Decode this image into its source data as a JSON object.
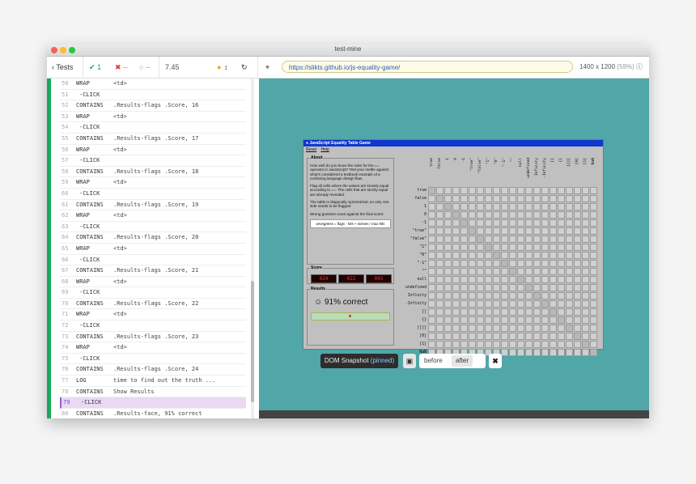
{
  "window": {
    "title": "test-mine"
  },
  "toolbar": {
    "tests_label": "Tests",
    "passed": "1",
    "failed": "--",
    "pending": "--",
    "duration": "7.45",
    "url": "https://slikts.github.io/js-equality-game/",
    "viewport": "1400 x 1200",
    "viewport_pct": "(59%)"
  },
  "commands": [
    {
      "n": "50",
      "name": "WRAP",
      "msg": "<td>",
      "child": false
    },
    {
      "n": "51",
      "name": "-CLICK",
      "msg": "",
      "child": true
    },
    {
      "n": "52",
      "name": "CONTAINS",
      "msg": ".Results-flags .Score, 16",
      "child": false
    },
    {
      "n": "53",
      "name": "WRAP",
      "msg": "<td>",
      "child": false
    },
    {
      "n": "54",
      "name": "-CLICK",
      "msg": "",
      "child": true
    },
    {
      "n": "55",
      "name": "CONTAINS",
      "msg": ".Results-flags .Score, 17",
      "child": false
    },
    {
      "n": "56",
      "name": "WRAP",
      "msg": "<td>",
      "child": false
    },
    {
      "n": "57",
      "name": "-CLICK",
      "msg": "",
      "child": true
    },
    {
      "n": "58",
      "name": "CONTAINS",
      "msg": ".Results-flags .Score, 18",
      "child": false
    },
    {
      "n": "59",
      "name": "WRAP",
      "msg": "<td>",
      "child": false
    },
    {
      "n": "60",
      "name": "-CLICK",
      "msg": "",
      "child": true
    },
    {
      "n": "61",
      "name": "CONTAINS",
      "msg": ".Results-flags .Score, 19",
      "child": false
    },
    {
      "n": "62",
      "name": "WRAP",
      "msg": "<td>",
      "child": false
    },
    {
      "n": "63",
      "name": "-CLICK",
      "msg": "",
      "child": true
    },
    {
      "n": "64",
      "name": "CONTAINS",
      "msg": ".Results-flags .Score, 20",
      "child": false
    },
    {
      "n": "65",
      "name": "WRAP",
      "msg": "<td>",
      "child": false
    },
    {
      "n": "66",
      "name": "-CLICK",
      "msg": "",
      "child": true
    },
    {
      "n": "67",
      "name": "CONTAINS",
      "msg": ".Results-flags .Score, 21",
      "child": false
    },
    {
      "n": "68",
      "name": "WRAP",
      "msg": "<td>",
      "child": false
    },
    {
      "n": "69",
      "name": "-CLICK",
      "msg": "",
      "child": true
    },
    {
      "n": "70",
      "name": "CONTAINS",
      "msg": ".Results-flags .Score, 22",
      "child": false
    },
    {
      "n": "71",
      "name": "WRAP",
      "msg": "<td>",
      "child": false
    },
    {
      "n": "72",
      "name": "-CLICK",
      "msg": "",
      "child": true
    },
    {
      "n": "73",
      "name": "CONTAINS",
      "msg": ".Results-flags .Score, 23",
      "child": false
    },
    {
      "n": "74",
      "name": "WRAP",
      "msg": "<td>",
      "child": false
    },
    {
      "n": "75",
      "name": "-CLICK",
      "msg": "",
      "child": true
    },
    {
      "n": "76",
      "name": "CONTAINS",
      "msg": ".Results-flags .Score, 24",
      "child": false
    },
    {
      "n": "77",
      "name": "LOG",
      "msg": "time to find out the truth ...",
      "child": false
    },
    {
      "n": "78",
      "name": "CONTAINS",
      "msg": "Show Results",
      "child": false
    },
    {
      "n": "79",
      "name": "-CLICK",
      "msg": "",
      "child": true,
      "pinned": true
    },
    {
      "n": "80",
      "name": "CONTAINS",
      "msg": ".Results-face, 91% correct",
      "child": false
    }
  ],
  "game": {
    "title": "JavaScript Equality Table Game",
    "menu": [
      "Reset",
      "Help"
    ],
    "about_title": "About",
    "about_p1": "How well do you know the rules for the == operator in JavaScript? Test your mettle against what's considered a textbook example of a confusing language design flaw.",
    "about_p2": "Flag all cells where the values are loosely equal according to ==. The cells that are strictly equal are already revealed.",
    "about_p3": "The table is diagonally symmetrical, so only one side needs to be flagged.",
    "about_p4": "Wrong guesses count against the final score:",
    "formula": "wrongness = flags - hits + misses / max hits",
    "score_title": "Score",
    "score_values": [
      "024",
      "022",
      "002"
    ],
    "results_title": "Results",
    "results_text": "91% correct",
    "labels": [
      "true",
      "false",
      "1",
      "0",
      "-1",
      "\"true\"",
      "\"false\"",
      "\"1\"",
      "\"0\"",
      "\"-1\"",
      "\"\"",
      "null",
      "undefined",
      "Infinity",
      "-Infinity",
      "[]",
      "{}",
      "[[]]",
      "[0]",
      "[1]",
      "NaN"
    ]
  },
  "snapshot": {
    "label": "DOM Snapshot",
    "pinned": "(pinned)",
    "before": "before",
    "after": "after",
    "close": "✖"
  }
}
